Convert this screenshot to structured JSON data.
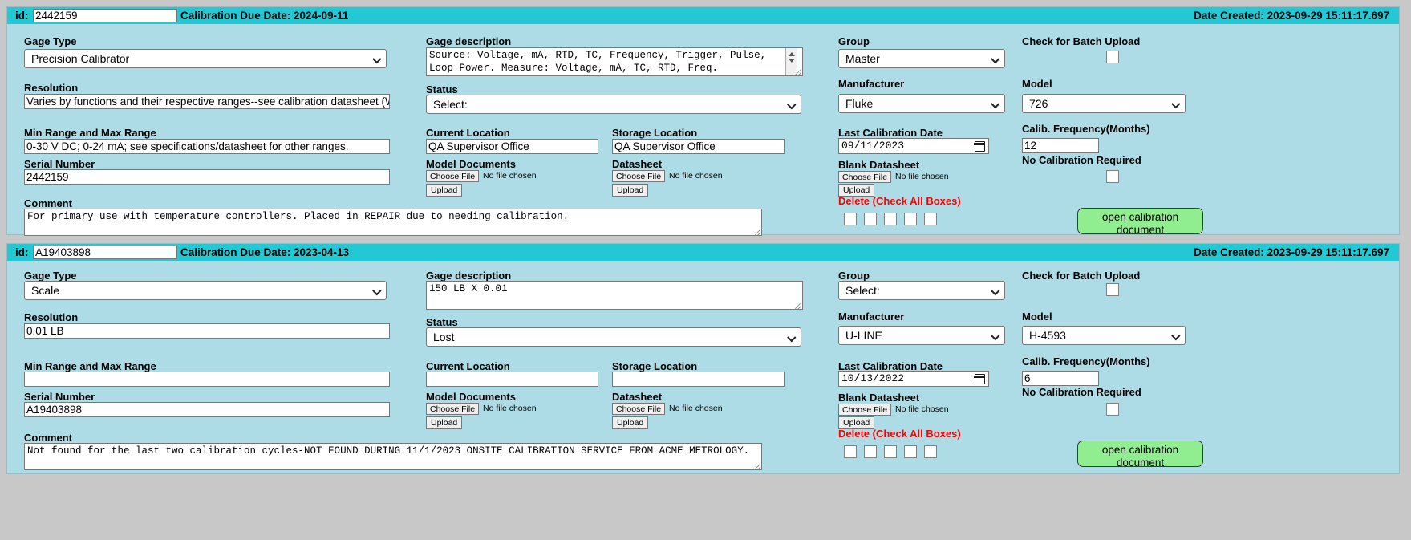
{
  "records": [
    {
      "id_label": "id:",
      "id_value": "2442159",
      "due_date": "Calibration Due Date: 2024-09-11",
      "date_created": "Date Created: 2023-09-29 15:11:17.697",
      "gage_type_label": "Gage Type",
      "gage_type_value": "Precision Calibrator",
      "resolution_label": "Resolution",
      "resolution_value": "Varies by functions and their respective ranges--see calibration datasheet (W",
      "range_label": "Min Range and Max Range",
      "range_value": "0-30 V DC; 0-24 mA; see specifications/datasheet for other ranges.",
      "serial_label": "Serial Number",
      "serial_value": "2442159",
      "comment_label": "Comment",
      "comment_value": "For primary use with temperature controllers. Placed in REPAIR due to needing calibration.",
      "gage_desc_label": "Gage description",
      "gage_desc_value": "Source: Voltage, mA, RTD, TC, Frequency, Trigger, Pulse,\nLoop Power. Measure: Voltage, mA, TC, RTD, Freq.",
      "status_label": "Status",
      "status_value": "Select:",
      "current_location_label": "Current Location",
      "current_location_value": "QA Supervisor Office",
      "storage_location_label": "Storage Location",
      "storage_location_value": "QA Supervisor Office",
      "model_documents_label": "Model Documents",
      "model_documents_file": "No file chosen",
      "datasheet_label": "Datasheet",
      "datasheet_file": "No file chosen",
      "choose_file_label": "Choose File",
      "upload_label": "Upload",
      "group_label": "Group",
      "group_value": "Master",
      "manufacturer_label": "Manufacturer",
      "manufacturer_value": "Fluke",
      "last_cal_label": "Last Calibration Date",
      "last_cal_value": "09/11/2023",
      "blank_datasheet_label": "Blank Datasheet",
      "blank_datasheet_file": "No file chosen",
      "delete_label": "Delete (Check All Boxes)",
      "batch_upload_label": "Check for Batch Upload",
      "model_label": "Model",
      "model_value": "726",
      "calib_freq_label": "Calib. Frequency(Months)",
      "calib_freq_value": "12",
      "no_cal_required_label": "No Calibration Required",
      "open_doc_label": "open calibration document"
    },
    {
      "id_label": "id:",
      "id_value": "A19403898",
      "due_date": "Calibration Due Date: 2023-04-13",
      "date_created": "Date Created: 2023-09-29 15:11:17.697",
      "gage_type_label": "Gage Type",
      "gage_type_value": "Scale",
      "resolution_label": "Resolution",
      "resolution_value": "0.01 LB",
      "range_label": "Min Range and Max Range",
      "range_value": "",
      "serial_label": "Serial Number",
      "serial_value": "A19403898",
      "comment_label": "Comment",
      "comment_value": "Not found for the last two calibration cycles-NOT FOUND DURING 11/1/2023 ONSITE CALIBRATION SERVICE FROM ACME METROLOGY.",
      "gage_desc_label": "Gage description",
      "gage_desc_value": "150 LB X 0.01",
      "status_label": "Status",
      "status_value": "Lost",
      "current_location_label": "Current Location",
      "current_location_value": "",
      "storage_location_label": "Storage Location",
      "storage_location_value": "",
      "model_documents_label": "Model Documents",
      "model_documents_file": "No file chosen",
      "datasheet_label": "Datasheet",
      "datasheet_file": "No file chosen",
      "choose_file_label": "Choose File",
      "upload_label": "Upload",
      "group_label": "Group",
      "group_value": "Select:",
      "manufacturer_label": "Manufacturer",
      "manufacturer_value": "U-LINE",
      "last_cal_label": "Last Calibration Date",
      "last_cal_value": "10/13/2022",
      "blank_datasheet_label": "Blank Datasheet",
      "blank_datasheet_file": "No file chosen",
      "delete_label": "Delete (Check All Boxes)",
      "batch_upload_label": "Check for Batch Upload",
      "model_label": "Model",
      "model_value": "H-4593",
      "calib_freq_label": "Calib. Frequency(Months)",
      "calib_freq_value": "6",
      "no_cal_required_label": "No Calibration Required",
      "open_doc_label": "open calibration document"
    }
  ],
  "colors": {
    "header_bar": "#22c9d4",
    "record_bg": "#addce6",
    "page_bg": "#c8c8c8",
    "delete_red": "#ff0000",
    "open_doc_green": "#90ee90"
  }
}
